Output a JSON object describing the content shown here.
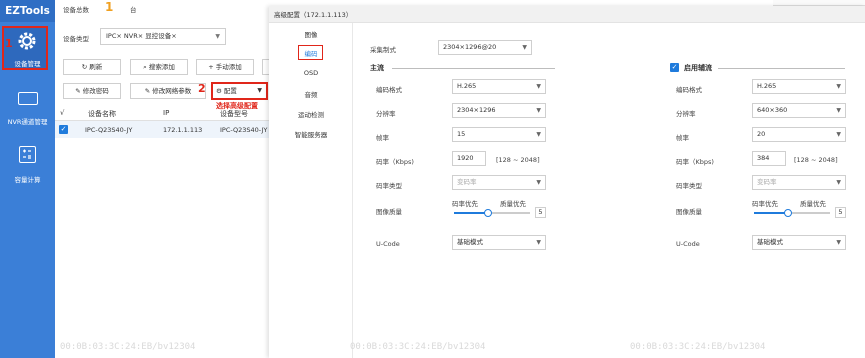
{
  "app": {
    "logo": "EZTools"
  },
  "sidebar": {
    "items": [
      {
        "label": "设备管理",
        "icon": "gear-icon"
      },
      {
        "label": "NVR通道管理",
        "icon": "nvr-icon"
      },
      {
        "label": "容量计算",
        "icon": "calculator-icon"
      }
    ]
  },
  "top": {
    "device_total_label": "设备总数",
    "count": "1",
    "unit": "台"
  },
  "filter": {
    "label": "设备类型",
    "chips": [
      "IPC",
      "NVR",
      "显控设备"
    ],
    "chip_remove": "×"
  },
  "toolbar": {
    "refresh": "刷新",
    "search_add": "搜索添加",
    "manual_add": "手动添加",
    "modify_pwd": "修改密码",
    "modify_net": "修改网络参数",
    "config": "配置"
  },
  "annotations": {
    "step1": "1",
    "step2": "2",
    "step2_text": "选择高级配置"
  },
  "table": {
    "columns": [
      "√",
      "设备名称",
      "IP",
      "设备型号"
    ],
    "rows": [
      {
        "name": "IPC-Q23S40-JY",
        "ip": "172.1.1.113",
        "model": "IPC-Q23S40-JY"
      }
    ]
  },
  "dialog": {
    "title": "高级配置（172.1.1.113）",
    "nav": [
      "图像",
      "编码",
      "OSD",
      "音频",
      "运动检测",
      "智能服务器"
    ],
    "capture_label": "采集制式",
    "capture_value": "2304×1296@20",
    "main": {
      "title": "主流",
      "codec_label": "编码格式",
      "codec": "H.265",
      "res_label": "分辨率",
      "res": "2304×1296",
      "fps_label": "帧率",
      "fps": "15",
      "bitrate_label": "码率（Kbps)",
      "bitrate": "1920",
      "range": "[128 ~ 2048]",
      "btype_label": "码率类型",
      "btype": "变码率",
      "quality_label": "图像质量",
      "q_left": "码率优先",
      "q_right": "质量优先",
      "q_value": "5",
      "ucode_label": "U-Code",
      "ucode": "基础模式"
    },
    "sub": {
      "title": "启用辅流",
      "checked": true,
      "codec_label": "编码格式",
      "codec": "H.265",
      "res_label": "分辨率",
      "res": "640×360",
      "fps_label": "帧率",
      "fps": "20",
      "bitrate_label": "码率（Kbps)",
      "bitrate": "384",
      "range": "[128 ~ 2048]",
      "btype_label": "码率类型",
      "btype": "变码率",
      "quality_label": "图像质量",
      "q_left": "码率优先",
      "q_right": "质量优先",
      "q_value": "5",
      "ucode_label": "U-Code",
      "ucode": "基础模式"
    }
  },
  "watermark": "00:0B:03:3C:24:EB/bv12304",
  "colors": {
    "sidebar": "#3b7fd7",
    "accent": "#1f7bdc",
    "annotation": "#e0261a"
  }
}
